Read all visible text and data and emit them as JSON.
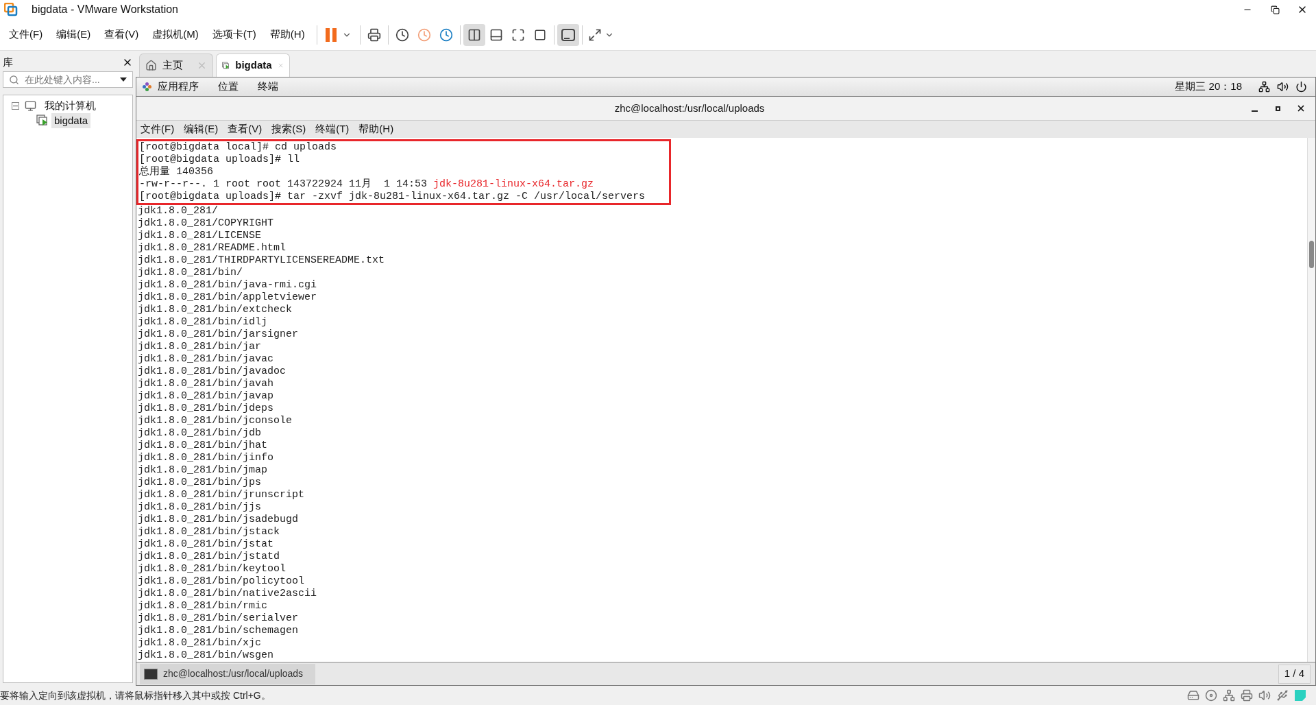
{
  "window": {
    "title": "bigdata - VMware Workstation"
  },
  "menu": [
    "文件(F)",
    "编辑(E)",
    "查看(V)",
    "虚拟机(M)",
    "选项卡(T)",
    "帮助(H)"
  ],
  "library": {
    "title": "库",
    "search": {
      "placeholder": "在此处键入内容..."
    },
    "tree": [
      {
        "label": "我的计算机",
        "expanded": true,
        "children": [
          {
            "label": "bigdata",
            "selected": true
          }
        ]
      }
    ]
  },
  "tabs": [
    {
      "label": "主页",
      "kind": "home",
      "selected": false
    },
    {
      "label": "bigdata",
      "kind": "vm",
      "selected": true
    }
  ],
  "guest_panel": {
    "menus": [
      "应用程序",
      "位置",
      "终端"
    ],
    "clock": "星期三 20：18"
  },
  "terminal": {
    "title": "zhc@localhost:/usr/local/uploads",
    "menu": [
      "文件(F)",
      "编辑(E)",
      "查看(V)",
      "搜索(S)",
      "终端(T)",
      "帮助(H)"
    ],
    "lines": [
      {
        "text": "[root@bigdata local]# cd uploads",
        "boxed": true
      },
      {
        "text": "[root@bigdata uploads]# ll",
        "boxed": true
      },
      {
        "text": "总用量 140356",
        "boxed": true
      },
      {
        "text": "-rw-r--r--. 1 root root 143722924 11月  1 14:53 ",
        "file": "jdk-8u281-linux-x64.tar.gz",
        "boxed": true
      },
      {
        "text": "[root@bigdata uploads]# tar -zxvf jdk-8u281-linux-x64.tar.gz -C /usr/local/servers",
        "boxed": true
      },
      {
        "text": "jdk1.8.0_281/"
      },
      {
        "text": "jdk1.8.0_281/COPYRIGHT"
      },
      {
        "text": "jdk1.8.0_281/LICENSE"
      },
      {
        "text": "jdk1.8.0_281/README.html"
      },
      {
        "text": "jdk1.8.0_281/THIRDPARTYLICENSEREADME.txt"
      },
      {
        "text": "jdk1.8.0_281/bin/"
      },
      {
        "text": "jdk1.8.0_281/bin/java-rmi.cgi"
      },
      {
        "text": "jdk1.8.0_281/bin/appletviewer"
      },
      {
        "text": "jdk1.8.0_281/bin/extcheck"
      },
      {
        "text": "jdk1.8.0_281/bin/idlj"
      },
      {
        "text": "jdk1.8.0_281/bin/jarsigner"
      },
      {
        "text": "jdk1.8.0_281/bin/jar"
      },
      {
        "text": "jdk1.8.0_281/bin/javac"
      },
      {
        "text": "jdk1.8.0_281/bin/javadoc"
      },
      {
        "text": "jdk1.8.0_281/bin/javah"
      },
      {
        "text": "jdk1.8.0_281/bin/javap"
      },
      {
        "text": "jdk1.8.0_281/bin/jdeps"
      },
      {
        "text": "jdk1.8.0_281/bin/jconsole"
      },
      {
        "text": "jdk1.8.0_281/bin/jdb"
      },
      {
        "text": "jdk1.8.0_281/bin/jhat"
      },
      {
        "text": "jdk1.8.0_281/bin/jinfo"
      },
      {
        "text": "jdk1.8.0_281/bin/jmap"
      },
      {
        "text": "jdk1.8.0_281/bin/jps"
      },
      {
        "text": "jdk1.8.0_281/bin/jrunscript"
      },
      {
        "text": "jdk1.8.0_281/bin/jjs"
      },
      {
        "text": "jdk1.8.0_281/bin/jsadebugd"
      },
      {
        "text": "jdk1.8.0_281/bin/jstack"
      },
      {
        "text": "jdk1.8.0_281/bin/jstat"
      },
      {
        "text": "jdk1.8.0_281/bin/jstatd"
      },
      {
        "text": "jdk1.8.0_281/bin/keytool"
      },
      {
        "text": "jdk1.8.0_281/bin/policytool"
      },
      {
        "text": "jdk1.8.0_281/bin/native2ascii"
      },
      {
        "text": "jdk1.8.0_281/bin/rmic"
      },
      {
        "text": "jdk1.8.0_281/bin/serialver"
      },
      {
        "text": "jdk1.8.0_281/bin/schemagen"
      },
      {
        "text": "jdk1.8.0_281/bin/xjc"
      },
      {
        "text": "jdk1.8.0_281/bin/wsgen"
      }
    ]
  },
  "taskbar": {
    "items": [
      {
        "label": "zhc@localhost:/usr/local/uploads",
        "selected": true
      }
    ],
    "workspace": "1 / 4"
  },
  "status_bar": {
    "message": "要将输入定向到该虚拟机，请将鼠标指针移入其中或按 Ctrl+G。"
  }
}
